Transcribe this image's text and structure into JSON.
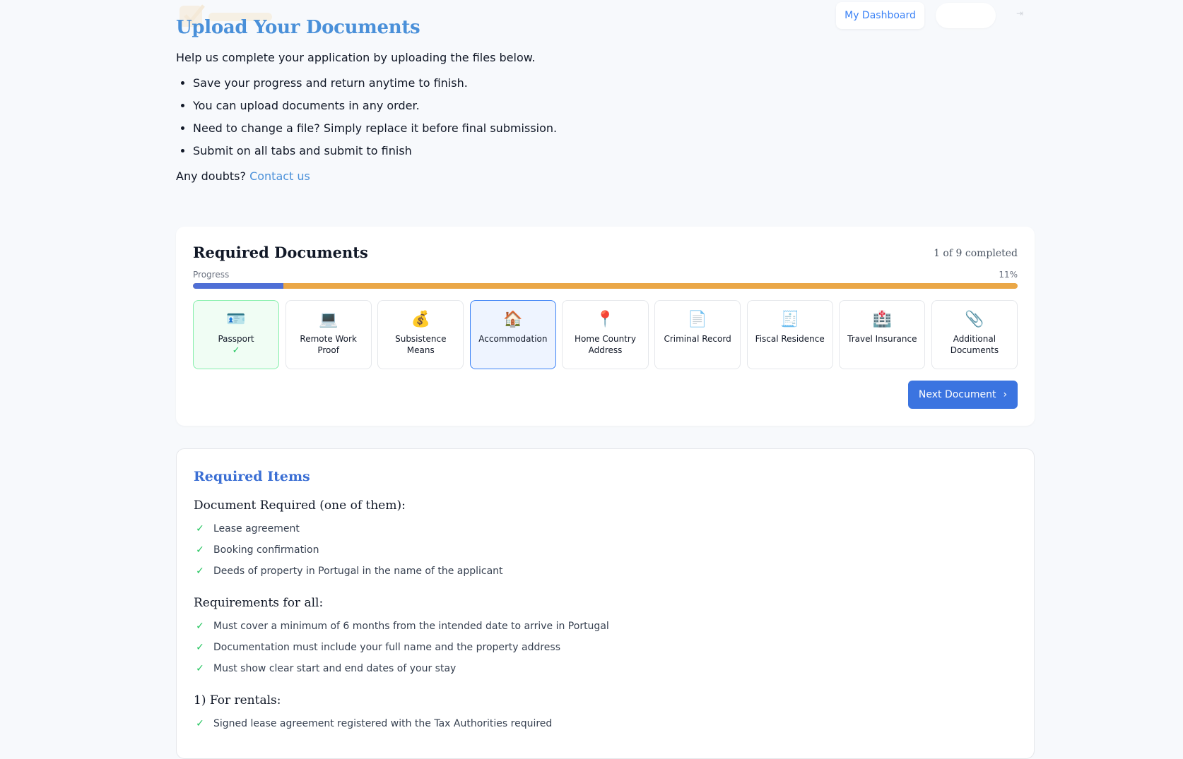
{
  "nav": {
    "dashboard_label": "My Dashboard"
  },
  "intro": {
    "title": "Upload Your Documents",
    "subtitle": "Help us complete your application by uploading the files below.",
    "bullets": [
      "Save your progress and return anytime to finish.",
      "You can upload documents in any order.",
      "Need to change a file? Simply replace it before final submission.",
      "Submit on all tabs and submit to finish"
    ],
    "doubts_prefix": "Any doubts?",
    "contact_link": "Contact us"
  },
  "documents": {
    "title": "Required Documents",
    "completed_text": "1 of 9 completed",
    "progress_label": "Progress",
    "progress_percent_text": "11%",
    "progress_fraction": 0.11,
    "tiles": [
      {
        "label": "Passport",
        "icon": "passport-icon",
        "emoji": "🪪",
        "status": "done",
        "check": "✓"
      },
      {
        "label": "Remote Work Proof",
        "icon": "laptop-icon",
        "emoji": "💻",
        "status": "pending"
      },
      {
        "label": "Subsistence Means",
        "icon": "money-bag-icon",
        "emoji": "💰",
        "status": "pending"
      },
      {
        "label": "Accommodation",
        "icon": "house-icon",
        "emoji": "🏠",
        "status": "active"
      },
      {
        "label": "Home Country Address",
        "icon": "pin-icon",
        "emoji": "📍",
        "status": "pending"
      },
      {
        "label": "Criminal Record",
        "icon": "document-icon",
        "emoji": "📄",
        "status": "pending"
      },
      {
        "label": "Fiscal Residence",
        "icon": "receipt-icon",
        "emoji": "🧾",
        "status": "pending"
      },
      {
        "label": "Travel Insurance",
        "icon": "hospital-icon",
        "emoji": "🏥",
        "status": "pending"
      },
      {
        "label": "Additional Documents",
        "icon": "paperclip-icon",
        "emoji": "📎",
        "status": "pending"
      }
    ],
    "next_button": "Next Document",
    "colors": {
      "progress_fill": "#4f6fd6",
      "progress_track": "#eaa747",
      "done": "#22c55e",
      "active": "#3b82f6"
    }
  },
  "required_items": {
    "title": "Required Items",
    "sections": [
      {
        "heading": "Document Required (one of them):",
        "items": [
          "Lease agreement",
          "Booking confirmation",
          "Deeds of property in Portugal in the name of the applicant"
        ]
      },
      {
        "heading": "Requirements for all:",
        "items": [
          "Must cover a minimum of 6 months from the intended date to arrive in Portugal",
          "Documentation must include your full name and the property address",
          "Must show clear start and end dates of your stay"
        ]
      },
      {
        "heading": "1) For rentals:",
        "items": [
          "Signed lease agreement registered with the Tax Authorities required"
        ]
      }
    ]
  }
}
